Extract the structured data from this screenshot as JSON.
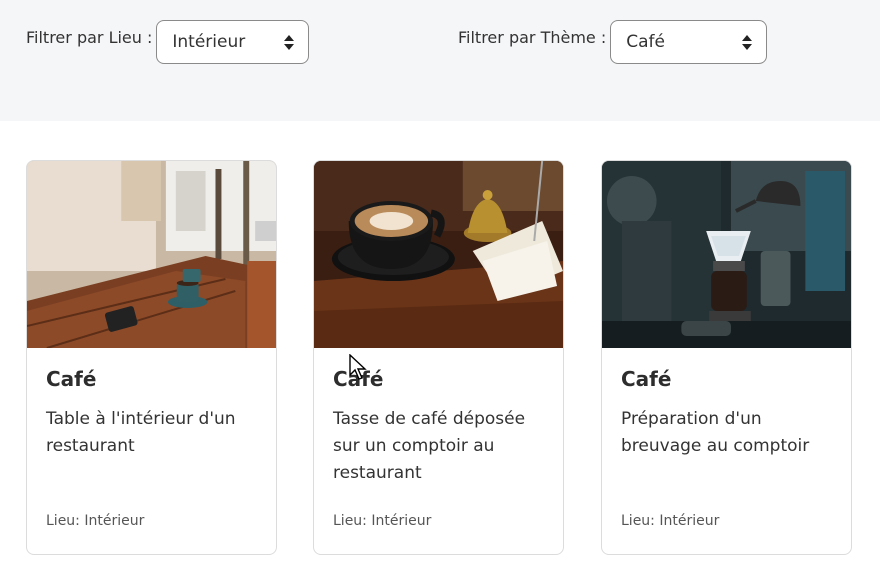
{
  "filters": {
    "lieu": {
      "label": "Filtrer par Lieu :",
      "selected": "Intérieur"
    },
    "theme": {
      "label": "Filtrer par Thème :",
      "selected": "Café"
    }
  },
  "cards": [
    {
      "title": "Café",
      "description": "Table à l'intérieur d'un restaurant",
      "meta": "Lieu: Intérieur",
      "image_icon": "restaurant-table-photo"
    },
    {
      "title": "Café",
      "description": "Tasse de café déposée sur un comptoir au restaurant",
      "meta": "Lieu: Intérieur",
      "image_icon": "coffee-cup-photo"
    },
    {
      "title": "Café",
      "description": "Préparation d'un breuvage au comptoir",
      "meta": "Lieu: Intérieur",
      "image_icon": "pour-over-coffee-photo"
    }
  ]
}
